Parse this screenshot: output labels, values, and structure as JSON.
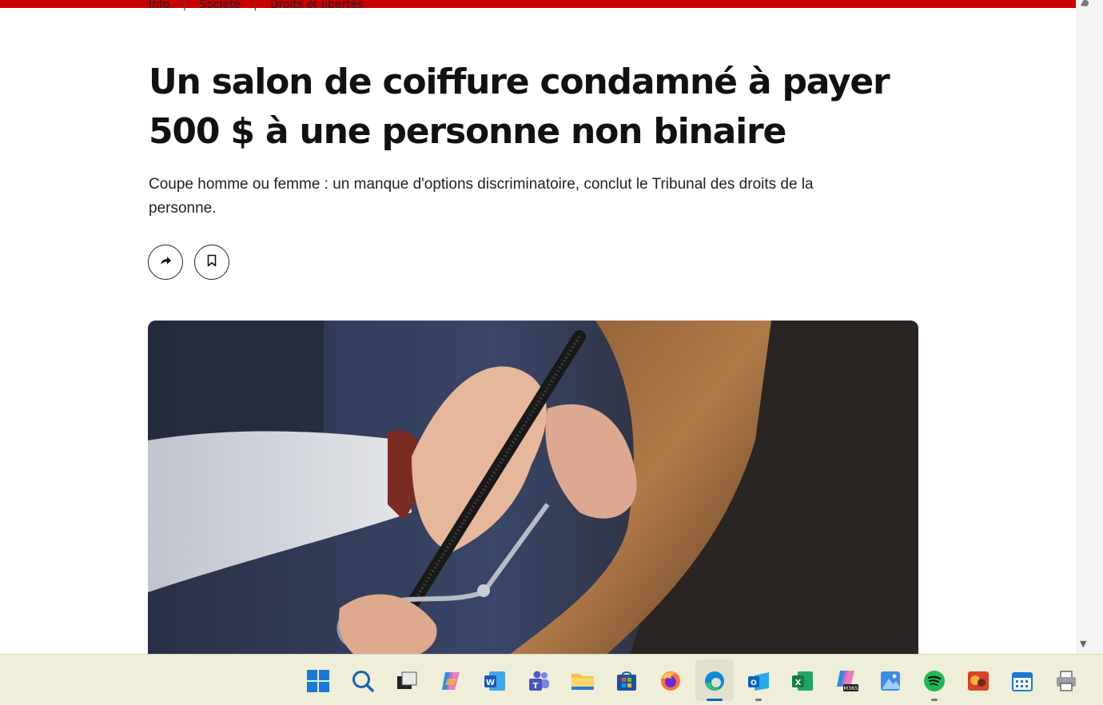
{
  "breadcrumb": [
    "Info",
    "Société",
    "Droits et libertés"
  ],
  "article": {
    "title": "Un salon de coiffure condamné à payer 500 $ à une personne non binaire",
    "subtitle": "Coupe homme ou femme : un manque d'options discriminatoire, conclut le Tribunal des droits de la personne."
  },
  "actions": {
    "share_icon": "share-arrow-icon",
    "bookmark_icon": "bookmark-icon"
  },
  "taskbar": {
    "apps": [
      "windows-start",
      "search",
      "task-view",
      "copilot",
      "word",
      "teams",
      "file-explorer",
      "microsoft-store",
      "firefox",
      "edge",
      "outlook",
      "excel",
      "m365",
      "photos",
      "spotify",
      "app-red",
      "calendar",
      "printer"
    ],
    "m365_label": "M365",
    "active_app": "edge"
  },
  "colors": {
    "accent_bar": "#c80000",
    "taskbar": "#efeed9"
  }
}
